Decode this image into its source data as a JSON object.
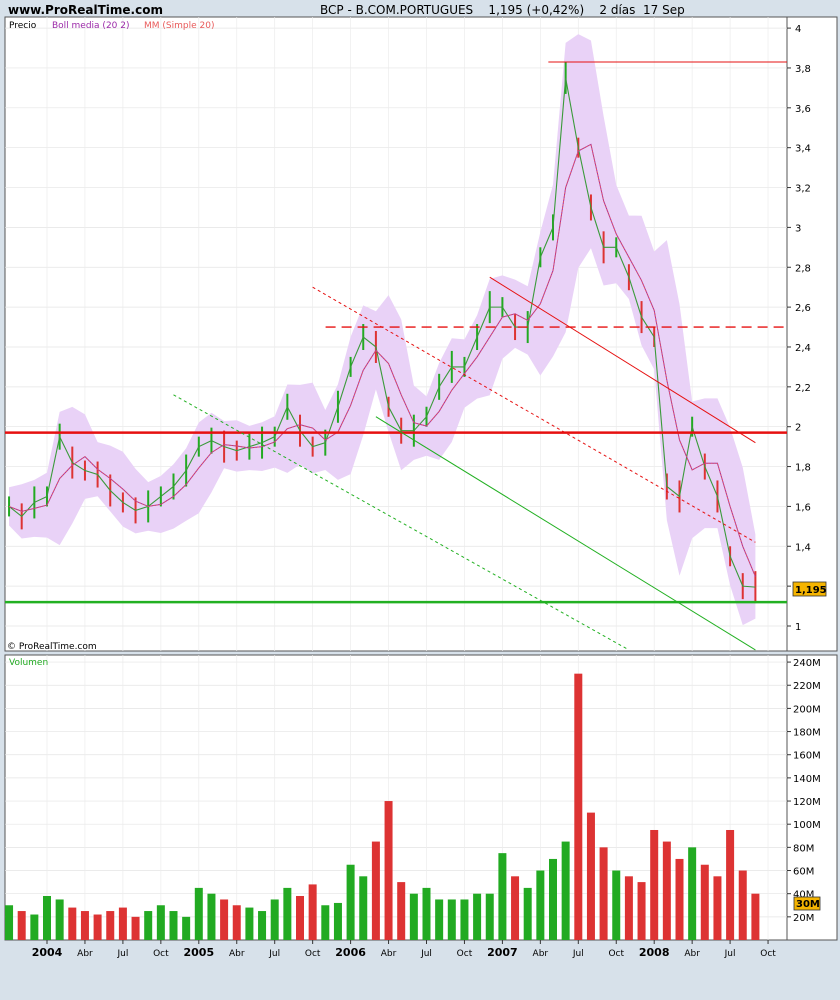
{
  "header": {
    "site": "www.ProRealTime.com",
    "title": "BCP - B.COM.PORTUGUES    1,195 (+0,42%)    2 días  17 Sep"
  },
  "legend": {
    "price_label": "Precio",
    "boll_label": "Boll media (20 2)",
    "mm_label": "MM (Simple 20)",
    "copyright": "© ProRealTime.com",
    "volume_label": "Volumen"
  },
  "colors": {
    "price_up": "#22aa22",
    "price_down": "#dd3333",
    "boll_band": "#e9d2f7",
    "boll_mid": "#9b2aa8",
    "mm": "#e85a5a",
    "support_green": "#22b022",
    "resistance_red": "#e61010",
    "last_price_tag": "#f5b400"
  },
  "chart_data": [
    {
      "type": "line",
      "title": "BCP - B.COM.PORTUGUES",
      "last_value": "1,195",
      "last_change": "+0,42%",
      "period": "2 días",
      "x_ticks": [
        "2004",
        "Abr",
        "Jul",
        "Oct",
        "2005",
        "Abr",
        "Jul",
        "Oct",
        "2006",
        "Abr",
        "Jul",
        "Oct",
        "2007",
        "Abr",
        "Jul",
        "Oct",
        "2008",
        "Abr",
        "Jul",
        "Oct"
      ],
      "y_ticks": [
        "1",
        "1,2",
        "1,4",
        "1,6",
        "1,8",
        "2",
        "2,2",
        "2,4",
        "2,6",
        "2,8",
        "3",
        "3,2",
        "3,4",
        "3,6",
        "3,8",
        "4"
      ],
      "ylim": [
        0.93,
        4.05
      ],
      "x_dates": [
        "2004-01",
        "2004-04",
        "2004-07",
        "2004-10",
        "2005-01",
        "2005-04",
        "2005-07",
        "2005-10",
        "2006-01",
        "2006-04",
        "2006-07",
        "2006-10",
        "2007-01",
        "2007-04",
        "2007-07",
        "2007-10",
        "2008-01",
        "2008-04",
        "2008-07",
        "2008-10"
      ],
      "series": [
        {
          "name": "Precio",
          "x": [
            "2003-10",
            "2003-11",
            "2003-12",
            "2004-01",
            "2004-02",
            "2004-03",
            "2004-04",
            "2004-05",
            "2004-06",
            "2004-07",
            "2004-08",
            "2004-09",
            "2004-10",
            "2004-11",
            "2004-12",
            "2005-01",
            "2005-02",
            "2005-03",
            "2005-04",
            "2005-05",
            "2005-06",
            "2005-07",
            "2005-08",
            "2005-09",
            "2005-10",
            "2005-11",
            "2005-12",
            "2006-01",
            "2006-02",
            "2006-03",
            "2006-04",
            "2006-05",
            "2006-06",
            "2006-07",
            "2006-08",
            "2006-09",
            "2006-10",
            "2006-11",
            "2006-12",
            "2007-01",
            "2007-02",
            "2007-03",
            "2007-04",
            "2007-05",
            "2007-06",
            "2007-07",
            "2007-08",
            "2007-09",
            "2007-10",
            "2007-11",
            "2007-12",
            "2008-01",
            "2008-02",
            "2008-03",
            "2008-04",
            "2008-05",
            "2008-06",
            "2008-07",
            "2008-08",
            "2008-09"
          ],
          "values": [
            1.6,
            1.55,
            1.62,
            1.65,
            1.95,
            1.82,
            1.78,
            1.76,
            1.68,
            1.62,
            1.58,
            1.6,
            1.65,
            1.7,
            1.78,
            1.9,
            1.93,
            1.9,
            1.88,
            1.9,
            1.92,
            1.95,
            2.1,
            1.98,
            1.9,
            1.92,
            2.1,
            2.3,
            2.45,
            2.4,
            2.1,
            1.98,
            1.98,
            2.05,
            2.2,
            2.3,
            2.3,
            2.45,
            2.6,
            2.6,
            2.5,
            2.5,
            2.85,
            3.0,
            3.75,
            3.4,
            3.1,
            2.9,
            2.9,
            2.75,
            2.55,
            2.45,
            1.7,
            1.65,
            2.0,
            1.8,
            1.65,
            1.35,
            1.2,
            1.195
          ]
        },
        {
          "name": "Boll media (20 2)"
        },
        {
          "name": "MM (Simple 20)"
        }
      ],
      "lines": [
        {
          "kind": "horizontal",
          "y": 1.97,
          "color": "red",
          "style": "solid"
        },
        {
          "kind": "horizontal",
          "y": 1.12,
          "color": "green",
          "style": "solid"
        },
        {
          "kind": "horizontal",
          "y": 2.5,
          "color": "red",
          "style": "dashed"
        },
        {
          "kind": "horizontal",
          "y": 3.83,
          "color": "red",
          "style": "thin"
        },
        {
          "kind": "trend",
          "color": "red",
          "style": "solid",
          "from": [
            "2006-12",
            2.75
          ],
          "to": [
            "2008-09",
            1.92
          ]
        },
        {
          "kind": "trend",
          "color": "red",
          "style": "dotted",
          "from": [
            "2005-10",
            2.7
          ],
          "to": [
            "2008-09",
            1.42
          ]
        },
        {
          "kind": "trend",
          "color": "green",
          "style": "solid",
          "from": [
            "2006-03",
            2.05
          ],
          "to": [
            "2008-09",
            0.88
          ]
        },
        {
          "kind": "trend",
          "color": "green",
          "style": "dotted",
          "from": [
            "2004-11",
            2.16
          ],
          "to": [
            "2007-11",
            0.88
          ]
        }
      ]
    },
    {
      "type": "bar",
      "title": "Volumen",
      "y_ticks": [
        "20M",
        "40M",
        "60M",
        "80M",
        "100M",
        "120M",
        "140M",
        "160M",
        "180M",
        "200M",
        "220M",
        "240M"
      ],
      "ylim": [
        0,
        245
      ],
      "last_value_tag": "30M",
      "x": [
        "2003-10",
        "2003-11",
        "2003-12",
        "2004-01",
        "2004-02",
        "2004-03",
        "2004-04",
        "2004-05",
        "2004-06",
        "2004-07",
        "2004-08",
        "2004-09",
        "2004-10",
        "2004-11",
        "2004-12",
        "2005-01",
        "2005-02",
        "2005-03",
        "2005-04",
        "2005-05",
        "2005-06",
        "2005-07",
        "2005-08",
        "2005-09",
        "2005-10",
        "2005-11",
        "2005-12",
        "2006-01",
        "2006-02",
        "2006-03",
        "2006-04",
        "2006-05",
        "2006-06",
        "2006-07",
        "2006-08",
        "2006-09",
        "2006-10",
        "2006-11",
        "2006-12",
        "2007-01",
        "2007-02",
        "2007-03",
        "2007-04",
        "2007-05",
        "2007-06",
        "2007-07",
        "2007-08",
        "2007-09",
        "2007-10",
        "2007-11",
        "2007-12",
        "2008-01",
        "2008-02",
        "2008-03",
        "2008-04",
        "2008-05",
        "2008-06",
        "2008-07",
        "2008-08",
        "2008-09"
      ],
      "values": [
        30,
        25,
        22,
        38,
        35,
        28,
        25,
        22,
        25,
        28,
        20,
        25,
        30,
        25,
        20,
        45,
        40,
        35,
        30,
        28,
        25,
        35,
        45,
        38,
        48,
        30,
        32,
        65,
        55,
        85,
        120,
        50,
        40,
        45,
        35,
        35,
        35,
        40,
        40,
        75,
        55,
        45,
        60,
        70,
        85,
        230,
        110,
        80,
        60,
        55,
        50,
        95,
        85,
        70,
        80,
        65,
        55,
        95,
        60,
        40
      ]
    }
  ]
}
